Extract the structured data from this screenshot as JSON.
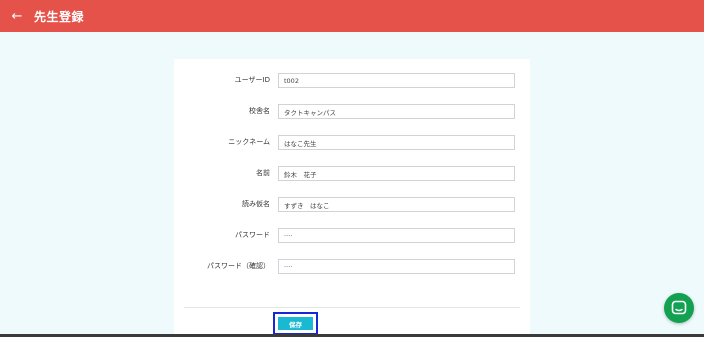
{
  "header": {
    "back_icon": "arrow-left-icon",
    "title": "先生登録",
    "color": "#e5524a"
  },
  "form": {
    "fields": [
      {
        "label": "ユーザーID",
        "value": "t002"
      },
      {
        "label": "校舎名",
        "value": "タクトキャンパス"
      },
      {
        "label": "ニックネーム",
        "value": "はなこ先生"
      },
      {
        "label": "名前",
        "value": "鈴木　花子"
      },
      {
        "label": "読み仮名",
        "value": "すずき　はなこ"
      },
      {
        "label": "パスワード",
        "value": "····"
      },
      {
        "label": "パスワード（確認）",
        "value": "····"
      }
    ],
    "save_label": "保存",
    "save_color": "#19b9d1"
  },
  "chat": {
    "icon": "chat-bubble-icon",
    "color": "#12a150"
  }
}
